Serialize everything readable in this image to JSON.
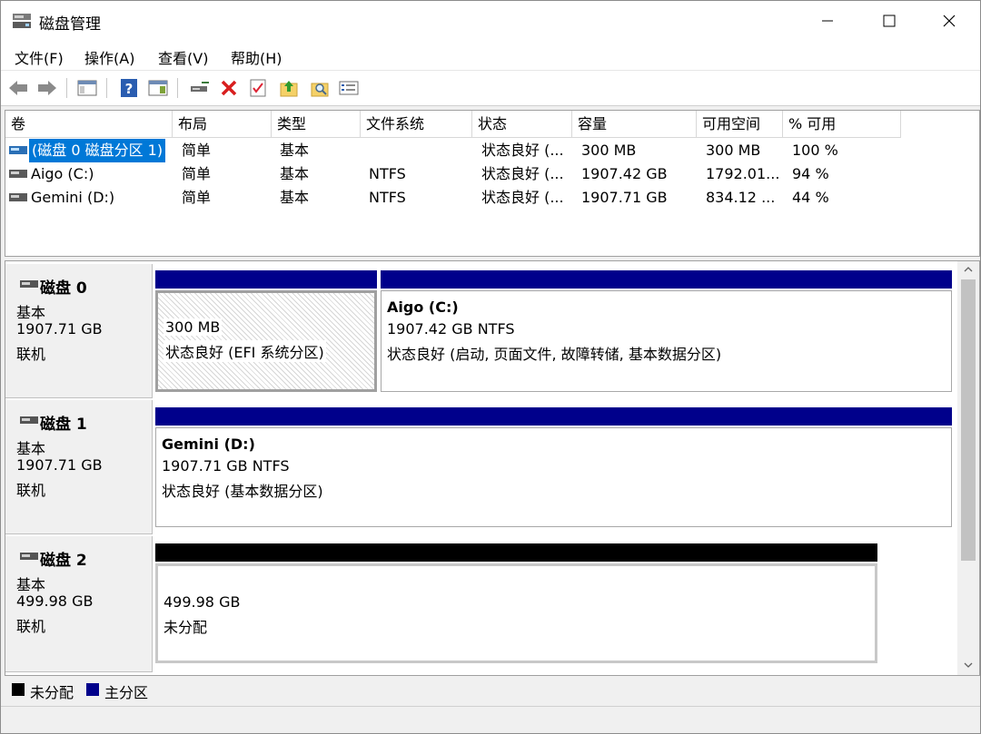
{
  "window": {
    "title": "磁盘管理"
  },
  "menu": [
    "文件(F)",
    "操作(A)",
    "查看(V)",
    "帮助(H)"
  ],
  "colors": {
    "primary_partition": "#00008b",
    "unallocated": "#000000",
    "selection": "#0078d7"
  },
  "volume_list": {
    "columns": [
      "卷",
      "布局",
      "类型",
      "文件系统",
      "状态",
      "容量",
      "可用空间",
      "% 可用"
    ],
    "rows": [
      [
        "(磁盘 0 磁盘分区 1)",
        "简单",
        "基本",
        "",
        "状态良好 (...",
        "300 MB",
        "300 MB",
        "100 %"
      ],
      [
        "Aigo (C:)",
        "简单",
        "基本",
        "NTFS",
        "状态良好 (...",
        "1907.42 GB",
        "1792.01...",
        "94 %"
      ],
      [
        "Gemini (D:)",
        "简单",
        "基本",
        "NTFS",
        "状态良好 (...",
        "1907.71 GB",
        "834.12 ...",
        "44 %"
      ]
    ]
  },
  "disks": [
    {
      "name": "磁盘 0",
      "type": "基本",
      "size": "1907.71 GB",
      "status": "联机",
      "partitions": [
        {
          "title": "",
          "size": "300 MB",
          "status": "状态良好 (EFI 系统分区)"
        },
        {
          "title": "Aigo  (C:)",
          "size": "1907.42 GB NTFS",
          "status": "状态良好 (启动, 页面文件, 故障转储, 基本数据分区)"
        }
      ]
    },
    {
      "name": "磁盘 1",
      "type": "基本",
      "size": "1907.71 GB",
      "status": "联机",
      "partitions": [
        {
          "title": "Gemini  (D:)",
          "size": "1907.71 GB NTFS",
          "status": "状态良好 (基本数据分区)"
        }
      ]
    },
    {
      "name": "磁盘 2",
      "type": "基本",
      "size": "499.98 GB",
      "status": "联机",
      "partitions": [
        {
          "title": "",
          "size": "499.98 GB",
          "status": "未分配"
        }
      ]
    }
  ],
  "legend": [
    "未分配",
    "主分区"
  ]
}
